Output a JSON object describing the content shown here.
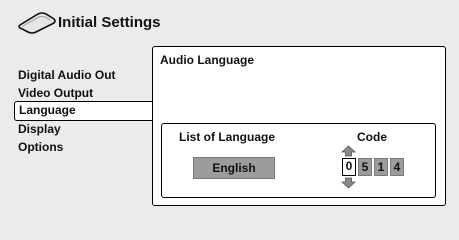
{
  "header": {
    "title": "Initial Settings",
    "icon": "disc-icon"
  },
  "sidebar": {
    "items": [
      {
        "label": "Digital Audio Out",
        "selected": false
      },
      {
        "label": "Video Output",
        "selected": false
      },
      {
        "label": "Language",
        "selected": true
      },
      {
        "label": "Display",
        "selected": false
      },
      {
        "label": "Options",
        "selected": false
      }
    ]
  },
  "panel": {
    "title": "Audio Language",
    "list_header": "List of Language",
    "code_header": "Code",
    "selected_language": "English",
    "code_digits": [
      "0",
      "5",
      "1",
      "4"
    ],
    "active_digit_index": 0
  },
  "colors": {
    "background": "#ebebeb",
    "panel": "#ffffff",
    "button_gray": "#9c9c9c",
    "border": "#000000"
  }
}
